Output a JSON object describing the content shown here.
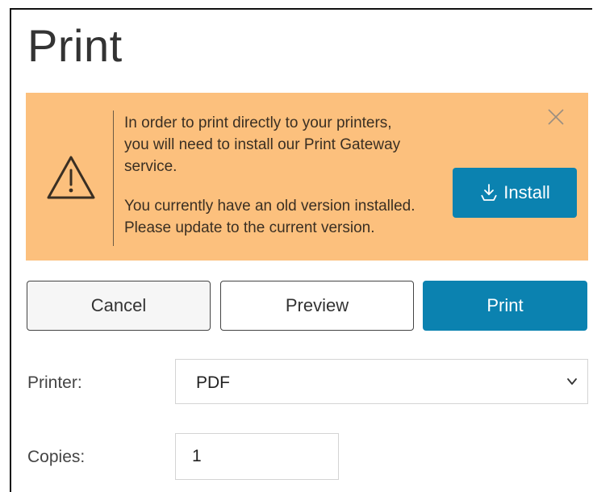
{
  "dialog": {
    "title": "Print"
  },
  "banner": {
    "background_color": "#fcc07d",
    "icon": "warning-triangle-icon",
    "message_line1": "In order to print directly to your printers,",
    "message_line2": "you will need to install our Print Gateway",
    "message_line3": "service.",
    "update_line1": "You currently have an old version installed.",
    "update_line2": "Please update to the current version.",
    "close_icon": "close-icon",
    "install_button": {
      "label": "Install",
      "icon": "install-download-icon",
      "color": "#0b82b0"
    }
  },
  "actions": {
    "cancel_label": "Cancel",
    "preview_label": "Preview",
    "print_label": "Print",
    "print_color": "#0b82b0"
  },
  "form": {
    "printer_label": "Printer:",
    "printer_value": "PDF",
    "copies_label": "Copies:",
    "copies_value": "1"
  }
}
